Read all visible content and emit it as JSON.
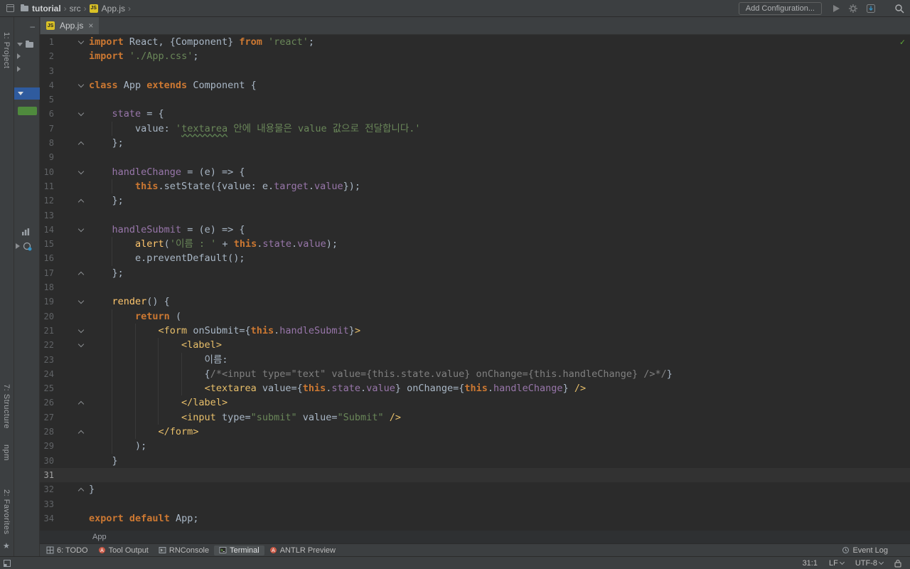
{
  "colors": {
    "editor_bg": "#2B2B2B",
    "panel_bg": "#3C3F41",
    "keyword": "#CC7832",
    "string": "#6A8759",
    "plain": "#A9B7C6",
    "field": "#9876AA",
    "function": "#FFC66D",
    "comment": "#808080",
    "jsx_tag": "#E8BF6A",
    "line_number": "#606366",
    "selection_blue": "#2F5B9E",
    "vcs_green": "#4F8A3D",
    "ok_green": "#5FAD37",
    "caret_row": "#323232"
  },
  "top_bar": {
    "breadcrumbs": [
      "tutorial",
      "src",
      "App.js"
    ],
    "separator": "›",
    "add_config_label": "Add Configuration..."
  },
  "left_stripe": {
    "project_label": "1: Project",
    "structure_label": "7: Structure",
    "npm_label": "npm",
    "favorites_label": "2: Favorites",
    "star_glyph": "★"
  },
  "project_panel": {
    "hide_glyph": "–"
  },
  "tab_bar": {
    "tabs": [
      {
        "label": "App.js",
        "close_glyph": "×",
        "active": true
      }
    ]
  },
  "editor": {
    "caret_line": 31,
    "ok_glyph": "✓",
    "lines": [
      {
        "n": 1,
        "fold": "d",
        "t": [
          [
            "kw",
            "import"
          ],
          [
            "def",
            " React, {Component} "
          ],
          [
            "kw",
            "from"
          ],
          [
            "def",
            " "
          ],
          [
            "str",
            "'react'"
          ],
          [
            "def",
            ";"
          ]
        ]
      },
      {
        "n": 2,
        "t": [
          [
            "kw",
            "import"
          ],
          [
            "def",
            " "
          ],
          [
            "str",
            "'./App.css'"
          ],
          [
            "def",
            ";"
          ]
        ]
      },
      {
        "n": 3,
        "t": []
      },
      {
        "n": 4,
        "fold": "d",
        "t": [
          [
            "kw",
            "class"
          ],
          [
            "def",
            " App "
          ],
          [
            "kw",
            "extends"
          ],
          [
            "def",
            " Component {"
          ]
        ]
      },
      {
        "n": 5,
        "t": []
      },
      {
        "n": 6,
        "fold": "d",
        "t": [
          [
            "def",
            "    "
          ],
          [
            "field",
            "state"
          ],
          [
            "def",
            " = {"
          ]
        ]
      },
      {
        "n": 7,
        "t": [
          [
            "def",
            "        value: "
          ],
          [
            "str",
            "'"
          ],
          [
            "strtypo",
            "textarea"
          ],
          [
            "str",
            " 안에 내용물은 value 값으로 전달합니다.'"
          ]
        ]
      },
      {
        "n": 8,
        "fold": "u",
        "t": [
          [
            "def",
            "    };"
          ]
        ]
      },
      {
        "n": 9,
        "t": []
      },
      {
        "n": 10,
        "fold": "d",
        "t": [
          [
            "def",
            "    "
          ],
          [
            "field",
            "handleChange"
          ],
          [
            "def",
            " = (e) => {"
          ]
        ]
      },
      {
        "n": 11,
        "t": [
          [
            "def",
            "        "
          ],
          [
            "kw",
            "this"
          ],
          [
            "def",
            ".setState({value: e."
          ],
          [
            "field",
            "target"
          ],
          [
            "def",
            "."
          ],
          [
            "field",
            "value"
          ],
          [
            "def",
            "});"
          ]
        ]
      },
      {
        "n": 12,
        "fold": "u",
        "t": [
          [
            "def",
            "    };"
          ]
        ]
      },
      {
        "n": 13,
        "t": []
      },
      {
        "n": 14,
        "fold": "d",
        "t": [
          [
            "def",
            "    "
          ],
          [
            "field",
            "handleSubmit"
          ],
          [
            "def",
            " = (e) => {"
          ]
        ]
      },
      {
        "n": 15,
        "t": [
          [
            "def",
            "        "
          ],
          [
            "fn",
            "alert"
          ],
          [
            "def",
            "("
          ],
          [
            "str",
            "'이름 : '"
          ],
          [
            "def",
            " + "
          ],
          [
            "kw",
            "this"
          ],
          [
            "def",
            "."
          ],
          [
            "field",
            "state"
          ],
          [
            "def",
            "."
          ],
          [
            "field",
            "value"
          ],
          [
            "def",
            ");"
          ]
        ]
      },
      {
        "n": 16,
        "t": [
          [
            "def",
            "        e.preventDefault();"
          ]
        ]
      },
      {
        "n": 17,
        "fold": "u",
        "t": [
          [
            "def",
            "    };"
          ]
        ]
      },
      {
        "n": 18,
        "t": []
      },
      {
        "n": 19,
        "fold": "d",
        "t": [
          [
            "def",
            "    "
          ],
          [
            "fn",
            "render"
          ],
          [
            "def",
            "() {"
          ]
        ]
      },
      {
        "n": 20,
        "t": [
          [
            "def",
            "        "
          ],
          [
            "kw",
            "return"
          ],
          [
            "def",
            " ("
          ]
        ]
      },
      {
        "n": 21,
        "fold": "d",
        "t": [
          [
            "def",
            "            "
          ],
          [
            "tag",
            "<form"
          ],
          [
            "def",
            " onSubmit={"
          ],
          [
            "kw",
            "this"
          ],
          [
            "def",
            "."
          ],
          [
            "field",
            "handleSubmit"
          ],
          [
            "def",
            "}"
          ],
          [
            "tag",
            ">"
          ]
        ]
      },
      {
        "n": 22,
        "fold": "d",
        "t": [
          [
            "def",
            "                "
          ],
          [
            "tag",
            "<label>"
          ]
        ]
      },
      {
        "n": 23,
        "t": [
          [
            "def",
            "                    이름:"
          ]
        ]
      },
      {
        "n": 24,
        "t": [
          [
            "def",
            "                    {"
          ],
          [
            "cmt",
            "/*<input type=\"text\" value={this.state.value} onChange={this.handleChange} />*/"
          ],
          [
            "def",
            "}"
          ]
        ]
      },
      {
        "n": 25,
        "t": [
          [
            "def",
            "                    "
          ],
          [
            "tag",
            "<textarea"
          ],
          [
            "def",
            " value={"
          ],
          [
            "kw",
            "this"
          ],
          [
            "def",
            "."
          ],
          [
            "field",
            "state"
          ],
          [
            "def",
            "."
          ],
          [
            "field",
            "value"
          ],
          [
            "def",
            "} onChange={"
          ],
          [
            "kw",
            "this"
          ],
          [
            "def",
            "."
          ],
          [
            "field",
            "handleChange"
          ],
          [
            "def",
            "} "
          ],
          [
            "tag",
            "/>"
          ]
        ]
      },
      {
        "n": 26,
        "fold": "u",
        "t": [
          [
            "def",
            "                "
          ],
          [
            "tag",
            "</label>"
          ]
        ]
      },
      {
        "n": 27,
        "t": [
          [
            "def",
            "                "
          ],
          [
            "tag",
            "<input"
          ],
          [
            "def",
            " type="
          ],
          [
            "str",
            "\"submit\""
          ],
          [
            "def",
            " value="
          ],
          [
            "str",
            "\"Submit\""
          ],
          [
            "def",
            " "
          ],
          [
            "tag",
            "/>"
          ]
        ]
      },
      {
        "n": 28,
        "fold": "u",
        "t": [
          [
            "def",
            "            "
          ],
          [
            "tag",
            "</form>"
          ]
        ]
      },
      {
        "n": 29,
        "t": [
          [
            "def",
            "        );"
          ]
        ]
      },
      {
        "n": 30,
        "t": [
          [
            "def",
            "    }"
          ]
        ]
      },
      {
        "n": 31,
        "t": []
      },
      {
        "n": 32,
        "fold": "u",
        "t": [
          [
            "def",
            "}"
          ]
        ]
      },
      {
        "n": 33,
        "t": []
      },
      {
        "n": 34,
        "t": [
          [
            "kw",
            "export"
          ],
          [
            "def",
            " "
          ],
          [
            "kw",
            "default"
          ],
          [
            "def",
            " App;"
          ]
        ]
      }
    ]
  },
  "breadcrumb_bar": {
    "items": [
      "App"
    ]
  },
  "bottom_stripe": {
    "left": [
      {
        "label": "6: TODO",
        "icon": "todo"
      },
      {
        "label": "Tool Output",
        "icon": "circleA"
      },
      {
        "label": "RNConsole",
        "icon": "console"
      },
      {
        "label": "Terminal",
        "icon": "terminal",
        "active": true
      },
      {
        "label": "ANTLR Preview",
        "icon": "circleA"
      }
    ],
    "right": [
      {
        "label": "Event Log",
        "icon": "event"
      }
    ]
  },
  "status_bar": {
    "cursor_position": "31:1",
    "line_separator": "LF",
    "encoding": "UTF-8"
  }
}
